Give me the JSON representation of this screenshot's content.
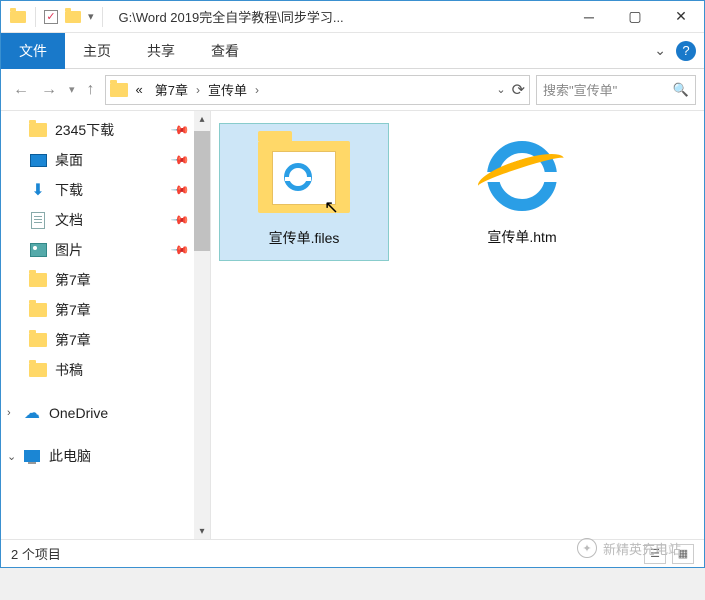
{
  "titlebar": {
    "title": "G:\\Word 2019完全自学教程\\同步学习..."
  },
  "ribbon": {
    "tabs": [
      "文件",
      "主页",
      "共享",
      "查看"
    ],
    "active_index": 0
  },
  "nav": {
    "crumbs": [
      "«",
      "第7章",
      "宣传单"
    ],
    "search_placeholder": "搜索\"宣传单\""
  },
  "sidebar": {
    "items": [
      {
        "label": "2345下载",
        "icon": "folder",
        "pinned": true
      },
      {
        "label": "桌面",
        "icon": "desktop",
        "pinned": true
      },
      {
        "label": "下载",
        "icon": "download",
        "pinned": true
      },
      {
        "label": "文档",
        "icon": "doc",
        "pinned": true
      },
      {
        "label": "图片",
        "icon": "pic",
        "pinned": true
      },
      {
        "label": "第7章",
        "icon": "folder",
        "pinned": false
      },
      {
        "label": "第7章",
        "icon": "folder",
        "pinned": false
      },
      {
        "label": "第7章",
        "icon": "folder",
        "pinned": false
      },
      {
        "label": "书稿",
        "icon": "folder",
        "pinned": false
      }
    ],
    "onedrive": "OneDrive",
    "thispc": "此电脑"
  },
  "files": [
    {
      "label": "宣传单.files",
      "type": "folder",
      "selected": true
    },
    {
      "label": "宣传单.htm",
      "type": "htm",
      "selected": false
    }
  ],
  "status": {
    "text": "2 个项目"
  },
  "watermark": "新精英充电站"
}
